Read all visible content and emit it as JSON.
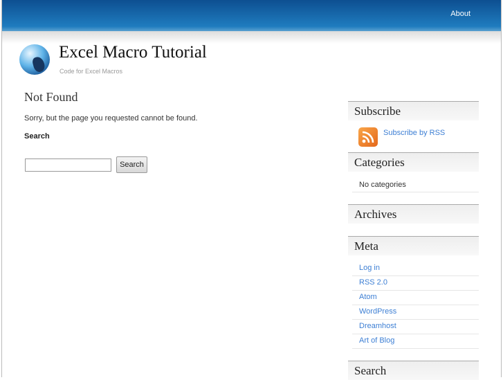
{
  "nav": {
    "about": "About"
  },
  "header": {
    "title": "Excel Macro Tutorial",
    "tagline": "Code for Excel Macros"
  },
  "main": {
    "heading": "Not Found",
    "message": "Sorry, but the page you requested cannot be found.",
    "search_label": "Search",
    "search_value": "",
    "search_button": "Search"
  },
  "sidebar": {
    "subscribe": {
      "title": "Subscribe",
      "rss_link": "Subscribe by RSS"
    },
    "categories": {
      "title": "Categories",
      "empty": "No categories"
    },
    "archives": {
      "title": "Archives"
    },
    "meta": {
      "title": "Meta",
      "items": [
        "Log in",
        "RSS 2.0",
        "Atom",
        "WordPress",
        "Dreamhost",
        "Art of Blog"
      ]
    },
    "search": {
      "title": "Search"
    }
  }
}
